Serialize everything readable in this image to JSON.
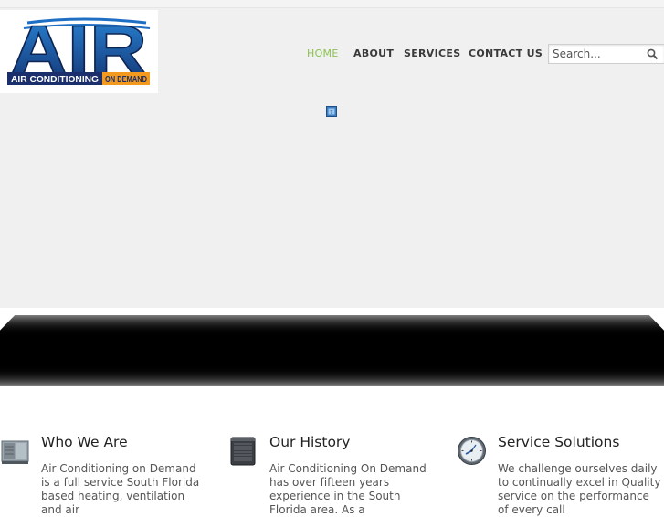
{
  "logo": {
    "big_text": "AIR",
    "line_left": "AIR CONDITIONING",
    "line_right": "ON DEMAND",
    "colors": {
      "navy": "#1a2f6b",
      "blue": "#1e6fc4",
      "orange": "#f39a1e"
    }
  },
  "nav": {
    "items": [
      {
        "label": "HOME",
        "active": true
      },
      {
        "label": "ABOUT"
      },
      {
        "label": "SERVICES"
      },
      {
        "label": "CONTACT US"
      }
    ],
    "active_color": "#8cc152"
  },
  "search": {
    "placeholder": "Search...",
    "icon": "magnifier-icon"
  },
  "hero": {
    "icon": "video-play-icon"
  },
  "features": [
    {
      "icon": "air-handler-unit-icon",
      "title": "Who We Are",
      "text": "Air Conditioning on Demand is a full service South Florida based heating, ventilation and air"
    },
    {
      "icon": "condenser-unit-icon",
      "title": "Our History",
      "text": "Air Conditioning On Demand has over fifteen years experience in the South Florida area. As a"
    },
    {
      "icon": "clock-icon",
      "title": "Service Solutions",
      "text": "We challenge ourselves daily to continually excel in Quality service on the performance of every call"
    }
  ]
}
